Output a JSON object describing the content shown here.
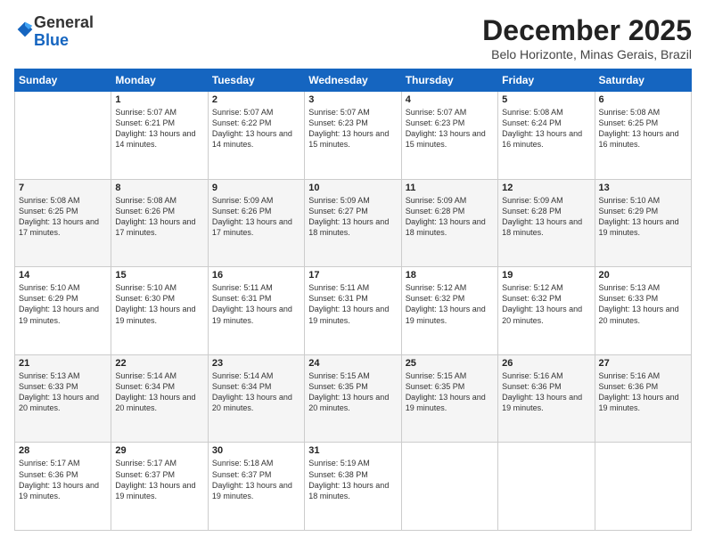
{
  "logo": {
    "general": "General",
    "blue": "Blue"
  },
  "header": {
    "month": "December 2025",
    "location": "Belo Horizonte, Minas Gerais, Brazil"
  },
  "weekdays": [
    "Sunday",
    "Monday",
    "Tuesday",
    "Wednesday",
    "Thursday",
    "Friday",
    "Saturday"
  ],
  "weeks": [
    [
      {
        "day": "",
        "sunrise": "",
        "sunset": "",
        "daylight": ""
      },
      {
        "day": "1",
        "sunrise": "Sunrise: 5:07 AM",
        "sunset": "Sunset: 6:21 PM",
        "daylight": "Daylight: 13 hours and 14 minutes."
      },
      {
        "day": "2",
        "sunrise": "Sunrise: 5:07 AM",
        "sunset": "Sunset: 6:22 PM",
        "daylight": "Daylight: 13 hours and 14 minutes."
      },
      {
        "day": "3",
        "sunrise": "Sunrise: 5:07 AM",
        "sunset": "Sunset: 6:23 PM",
        "daylight": "Daylight: 13 hours and 15 minutes."
      },
      {
        "day": "4",
        "sunrise": "Sunrise: 5:07 AM",
        "sunset": "Sunset: 6:23 PM",
        "daylight": "Daylight: 13 hours and 15 minutes."
      },
      {
        "day": "5",
        "sunrise": "Sunrise: 5:08 AM",
        "sunset": "Sunset: 6:24 PM",
        "daylight": "Daylight: 13 hours and 16 minutes."
      },
      {
        "day": "6",
        "sunrise": "Sunrise: 5:08 AM",
        "sunset": "Sunset: 6:25 PM",
        "daylight": "Daylight: 13 hours and 16 minutes."
      }
    ],
    [
      {
        "day": "7",
        "sunrise": "Sunrise: 5:08 AM",
        "sunset": "Sunset: 6:25 PM",
        "daylight": "Daylight: 13 hours and 17 minutes."
      },
      {
        "day": "8",
        "sunrise": "Sunrise: 5:08 AM",
        "sunset": "Sunset: 6:26 PM",
        "daylight": "Daylight: 13 hours and 17 minutes."
      },
      {
        "day": "9",
        "sunrise": "Sunrise: 5:09 AM",
        "sunset": "Sunset: 6:26 PM",
        "daylight": "Daylight: 13 hours and 17 minutes."
      },
      {
        "day": "10",
        "sunrise": "Sunrise: 5:09 AM",
        "sunset": "Sunset: 6:27 PM",
        "daylight": "Daylight: 13 hours and 18 minutes."
      },
      {
        "day": "11",
        "sunrise": "Sunrise: 5:09 AM",
        "sunset": "Sunset: 6:28 PM",
        "daylight": "Daylight: 13 hours and 18 minutes."
      },
      {
        "day": "12",
        "sunrise": "Sunrise: 5:09 AM",
        "sunset": "Sunset: 6:28 PM",
        "daylight": "Daylight: 13 hours and 18 minutes."
      },
      {
        "day": "13",
        "sunrise": "Sunrise: 5:10 AM",
        "sunset": "Sunset: 6:29 PM",
        "daylight": "Daylight: 13 hours and 19 minutes."
      }
    ],
    [
      {
        "day": "14",
        "sunrise": "Sunrise: 5:10 AM",
        "sunset": "Sunset: 6:29 PM",
        "daylight": "Daylight: 13 hours and 19 minutes."
      },
      {
        "day": "15",
        "sunrise": "Sunrise: 5:10 AM",
        "sunset": "Sunset: 6:30 PM",
        "daylight": "Daylight: 13 hours and 19 minutes."
      },
      {
        "day": "16",
        "sunrise": "Sunrise: 5:11 AM",
        "sunset": "Sunset: 6:31 PM",
        "daylight": "Daylight: 13 hours and 19 minutes."
      },
      {
        "day": "17",
        "sunrise": "Sunrise: 5:11 AM",
        "sunset": "Sunset: 6:31 PM",
        "daylight": "Daylight: 13 hours and 19 minutes."
      },
      {
        "day": "18",
        "sunrise": "Sunrise: 5:12 AM",
        "sunset": "Sunset: 6:32 PM",
        "daylight": "Daylight: 13 hours and 19 minutes."
      },
      {
        "day": "19",
        "sunrise": "Sunrise: 5:12 AM",
        "sunset": "Sunset: 6:32 PM",
        "daylight": "Daylight: 13 hours and 20 minutes."
      },
      {
        "day": "20",
        "sunrise": "Sunrise: 5:13 AM",
        "sunset": "Sunset: 6:33 PM",
        "daylight": "Daylight: 13 hours and 20 minutes."
      }
    ],
    [
      {
        "day": "21",
        "sunrise": "Sunrise: 5:13 AM",
        "sunset": "Sunset: 6:33 PM",
        "daylight": "Daylight: 13 hours and 20 minutes."
      },
      {
        "day": "22",
        "sunrise": "Sunrise: 5:14 AM",
        "sunset": "Sunset: 6:34 PM",
        "daylight": "Daylight: 13 hours and 20 minutes."
      },
      {
        "day": "23",
        "sunrise": "Sunrise: 5:14 AM",
        "sunset": "Sunset: 6:34 PM",
        "daylight": "Daylight: 13 hours and 20 minutes."
      },
      {
        "day": "24",
        "sunrise": "Sunrise: 5:15 AM",
        "sunset": "Sunset: 6:35 PM",
        "daylight": "Daylight: 13 hours and 20 minutes."
      },
      {
        "day": "25",
        "sunrise": "Sunrise: 5:15 AM",
        "sunset": "Sunset: 6:35 PM",
        "daylight": "Daylight: 13 hours and 19 minutes."
      },
      {
        "day": "26",
        "sunrise": "Sunrise: 5:16 AM",
        "sunset": "Sunset: 6:36 PM",
        "daylight": "Daylight: 13 hours and 19 minutes."
      },
      {
        "day": "27",
        "sunrise": "Sunrise: 5:16 AM",
        "sunset": "Sunset: 6:36 PM",
        "daylight": "Daylight: 13 hours and 19 minutes."
      }
    ],
    [
      {
        "day": "28",
        "sunrise": "Sunrise: 5:17 AM",
        "sunset": "Sunset: 6:36 PM",
        "daylight": "Daylight: 13 hours and 19 minutes."
      },
      {
        "day": "29",
        "sunrise": "Sunrise: 5:17 AM",
        "sunset": "Sunset: 6:37 PM",
        "daylight": "Daylight: 13 hours and 19 minutes."
      },
      {
        "day": "30",
        "sunrise": "Sunrise: 5:18 AM",
        "sunset": "Sunset: 6:37 PM",
        "daylight": "Daylight: 13 hours and 19 minutes."
      },
      {
        "day": "31",
        "sunrise": "Sunrise: 5:19 AM",
        "sunset": "Sunset: 6:38 PM",
        "daylight": "Daylight: 13 hours and 18 minutes."
      },
      {
        "day": "",
        "sunrise": "",
        "sunset": "",
        "daylight": ""
      },
      {
        "day": "",
        "sunrise": "",
        "sunset": "",
        "daylight": ""
      },
      {
        "day": "",
        "sunrise": "",
        "sunset": "",
        "daylight": ""
      }
    ]
  ]
}
